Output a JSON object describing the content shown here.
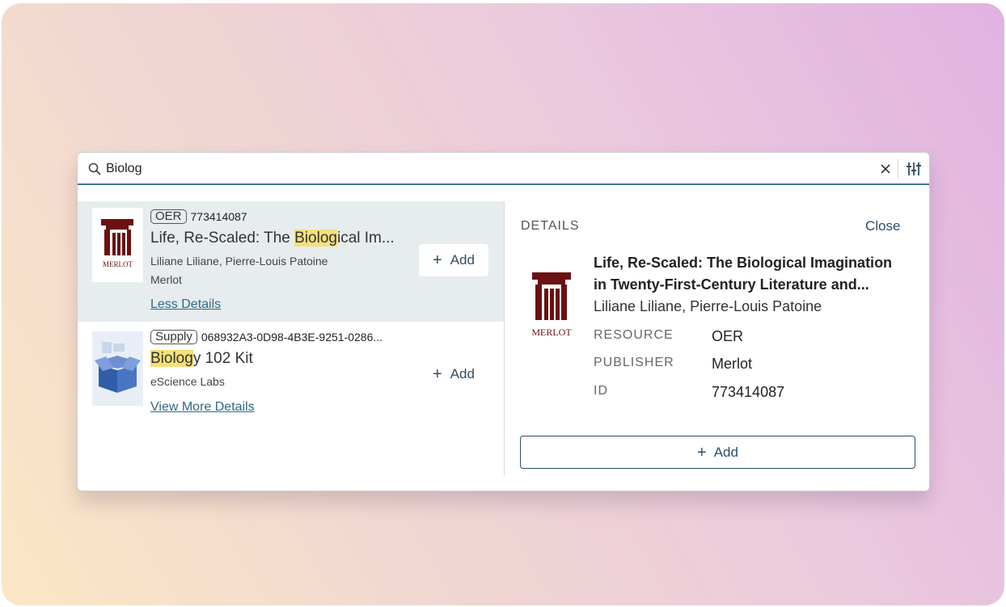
{
  "search": {
    "value": "Biolog",
    "clear_icon": "close-icon",
    "filter_icon": "sliders-icon"
  },
  "results": [
    {
      "badge": "OER",
      "id": "773414087",
      "title_pre": "Life, Re-Scaled: The ",
      "title_match": "Biolog",
      "title_post": "ical Im...",
      "authors": "Liliane Liliane, Pierre-Louis Patoine",
      "publisher": "Merlot",
      "link": "Less Details",
      "add_label": "Add",
      "logo_text": "MERLOT",
      "selected": true
    },
    {
      "badge": "Supply",
      "id": "068932A3-0D98-4B3E-9251-0286...",
      "title_pre": "",
      "title_match": "Biolog",
      "title_post": "y 102 Kit",
      "publisher": "eScience Labs",
      "link": "View More Details",
      "add_label": "Add",
      "selected": false
    }
  ],
  "details": {
    "heading": "DETAILS",
    "close_label": "Close",
    "logo_text": "MERLOT",
    "title_line1": "Life, Re-Scaled: The Biological Imagination",
    "title_line2": "in Twenty-First-Century Literature and...",
    "authors": "Liliane Liliane, Pierre-Louis Patoine",
    "fields": [
      {
        "key": "RESOURCE",
        "value": "OER"
      },
      {
        "key": "PUBLISHER",
        "value": "Merlot"
      },
      {
        "key": "ID",
        "value": "773414087"
      }
    ],
    "add_label": "Add"
  },
  "colors": {
    "accent": "#3e7a93",
    "button_text": "#2c4e66",
    "highlight": "#f5e07a",
    "merlot": "#6b1111",
    "selected_row": "#e7ecef"
  }
}
